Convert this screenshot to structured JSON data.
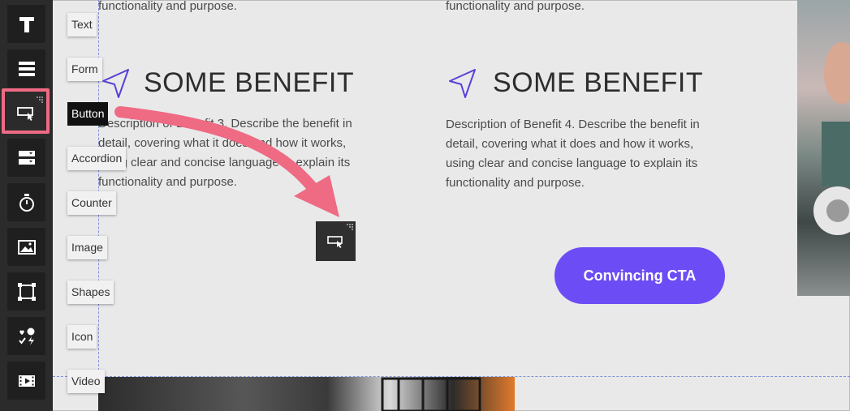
{
  "toolbar": {
    "items": [
      {
        "name": "text-tool",
        "icon": "text-icon"
      },
      {
        "name": "form-tool",
        "icon": "form-icon"
      },
      {
        "name": "button-tool",
        "icon": "button-cursor-icon"
      },
      {
        "name": "accordion-tool",
        "icon": "accordion-icon"
      },
      {
        "name": "counter-tool",
        "icon": "stopwatch-icon"
      },
      {
        "name": "image-tool",
        "icon": "image-icon"
      },
      {
        "name": "shapes-tool",
        "icon": "shapes-icon"
      },
      {
        "name": "icon-tool",
        "icon": "emoji-icon"
      },
      {
        "name": "video-tool",
        "icon": "video-icon"
      }
    ],
    "labels": [
      "Text",
      "Form",
      "Button",
      "Accordion",
      "Counter",
      "Image",
      "Shapes",
      "Icon",
      "Video"
    ]
  },
  "content": {
    "fragment_left": "functionality and purpose.",
    "fragment_right": "functionality and purpose.",
    "benefit_left": {
      "title": "SOME BENEFIT",
      "lines": [
        "Description of Benefit 3. Describe the benefit in",
        "detail, covering what it does and how it works,",
        "using clear and concise language to explain its",
        "functionality and purpose."
      ]
    },
    "benefit_right": {
      "title": "SOME BENEFIT",
      "lines": [
        "Description of Benefit 4. Describe the benefit in",
        "detail, covering what it does and how it works,",
        "using clear and concise language to explain its",
        "functionality and purpose."
      ]
    },
    "cta_label": "Convincing CTA"
  },
  "colors": {
    "accent": "#6c4df5",
    "highlight": "#ef6a83",
    "sidebar": "#2b2b2b",
    "canvas": "#e9e9ea"
  }
}
